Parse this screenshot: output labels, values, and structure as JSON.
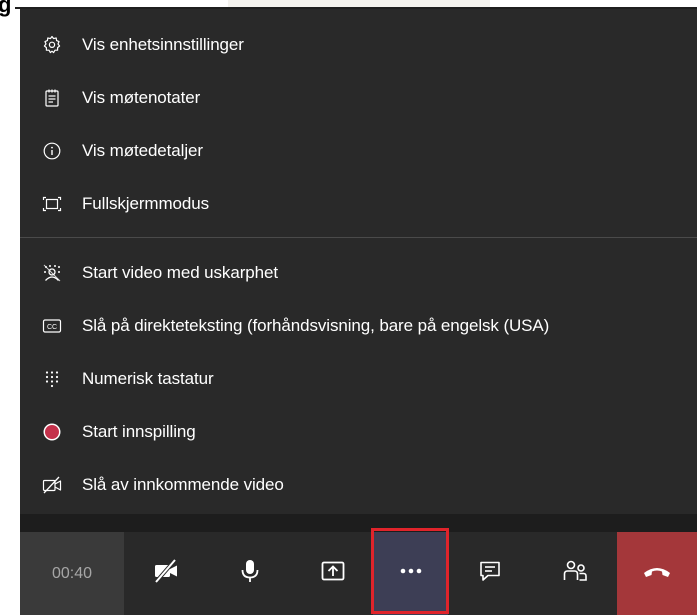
{
  "top_fragment": "g",
  "menu": {
    "items": [
      {
        "label": "Vis enhetsinnstillinger",
        "icon": "gear-icon"
      },
      {
        "label": "Vis møtenotater",
        "icon": "notes-icon"
      },
      {
        "label": "Vis møtedetaljer",
        "icon": "info-icon"
      },
      {
        "label": "Fullskjermmodus",
        "icon": "fullscreen-icon"
      },
      {
        "label": "Start video med uskarphet",
        "icon": "blur-background-icon"
      },
      {
        "label": "Slå på direkteteksting (forhåndsvisning, bare på engelsk (USA)",
        "icon": "closed-captions-icon"
      },
      {
        "label": "Numerisk tastatur",
        "icon": "dialpad-icon"
      },
      {
        "label": "Start innspilling",
        "icon": "record-icon"
      },
      {
        "label": "Slå av innkommende video",
        "icon": "video-off-icon"
      }
    ]
  },
  "toolbar": {
    "timer": "00:40",
    "buttons": [
      "camera-off-icon",
      "microphone-icon",
      "share-screen-icon",
      "more-options-icon",
      "chat-icon",
      "participants-icon",
      "hang-up-icon"
    ]
  },
  "colors": {
    "menu_bg": "#292929",
    "toolbar_bg": "#292929",
    "more_active_bg": "#3d3e55",
    "hangup_bg": "#a4373a",
    "record_red": "#c4314b",
    "highlight_border": "#e0242b"
  }
}
